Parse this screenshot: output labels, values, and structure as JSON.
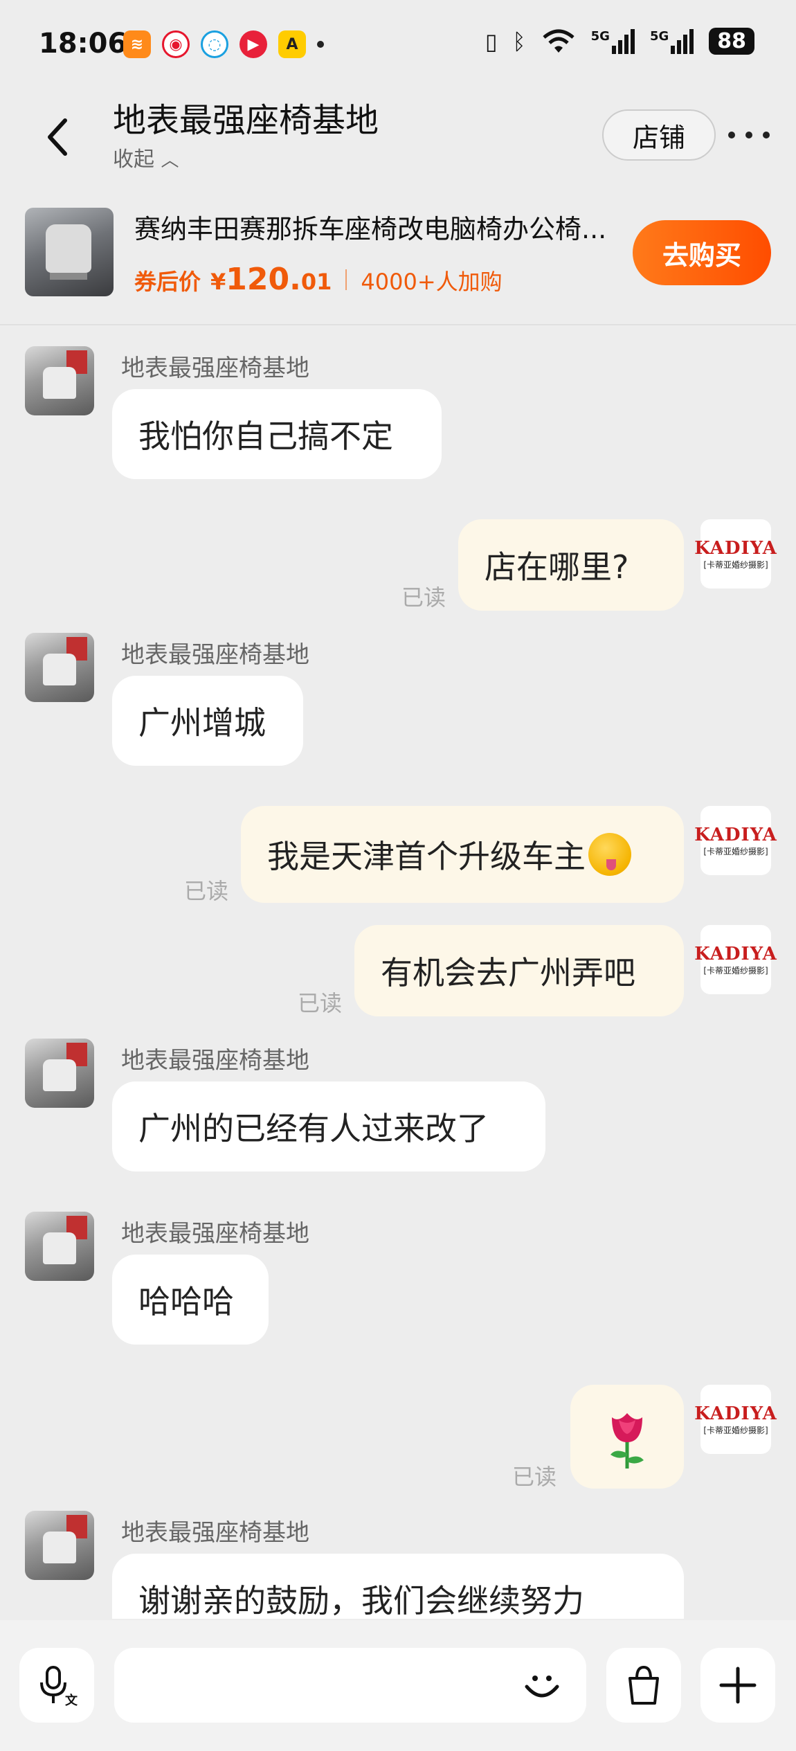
{
  "status_bar": {
    "time": "18:06",
    "battery": "88",
    "signal_1": "5G",
    "signal_2": "5G",
    "icons": [
      "vibrate-icon",
      "bluetooth-icon",
      "wifi-icon",
      "signal-icon",
      "signal-icon"
    ]
  },
  "header": {
    "title": "地表最强座椅基地",
    "subtitle": "收起",
    "store_label": "店铺"
  },
  "product": {
    "name": "赛纳丰田赛那拆车座椅改电脑椅办公椅...",
    "price_label": "券后价",
    "currency": "¥",
    "price_int": "120.",
    "price_dec": "01",
    "added_count": "4000+人加购",
    "buy_label": "去购买"
  },
  "messages": [
    {
      "sender": "地表最强座椅基地",
      "text": "我怕你自己搞不定"
    },
    {
      "text": "店在哪里?",
      "status": "已读"
    },
    {
      "sender": "地表最强座椅基地",
      "text": "广州增城"
    },
    {
      "text": "我是天津首个升级车主",
      "status": "已读"
    },
    {
      "text": "有机会去广州弄吧",
      "status": "已读"
    },
    {
      "sender": "地表最强座椅基地",
      "text": "广州的已经有人过来改了"
    },
    {
      "sender": "地表最强座椅基地",
      "text": "哈哈哈"
    },
    {
      "text": "",
      "status": "已读"
    },
    {
      "sender": "地表最强座椅基地",
      "text": "谢谢亲的鼓励，我们会继续努力"
    }
  ],
  "my_avatar": {
    "brand": "KADIYA",
    "subtitle": "[卡蒂亚婚纱摄影]"
  },
  "colors": {
    "accent": "#ff5500",
    "price": "#f05a0a",
    "bubble_out": "#fdf7e8",
    "background": "#ededed"
  }
}
